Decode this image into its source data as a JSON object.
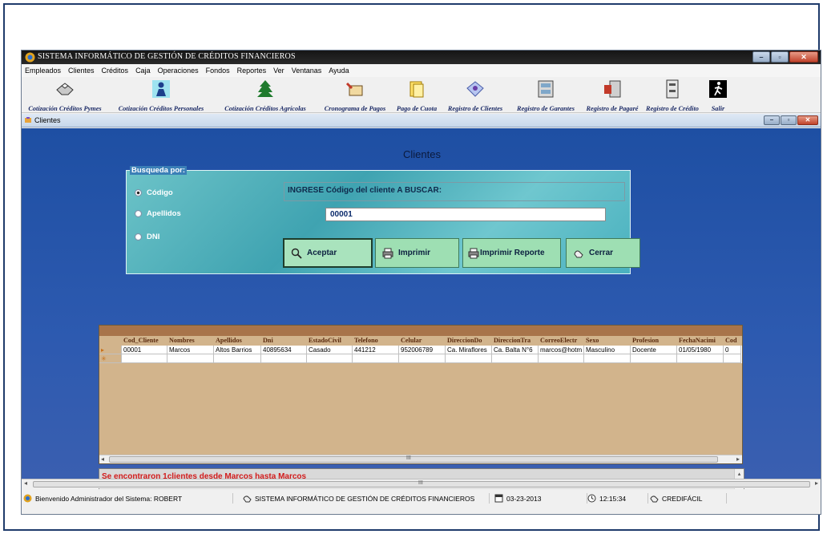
{
  "window": {
    "title": "SISTEMA INFORMÁTICO DE GESTIÓN DE CRÉDITOS FINANCIEROS"
  },
  "menu": [
    "Empleados",
    "Clientes",
    "Créditos",
    "Caja",
    "Operaciones",
    "Fondos",
    "Reportes",
    "Ver",
    "Ventanas",
    "Ayuda"
  ],
  "toolbar": [
    {
      "label": "Cotización Créditos Pymes",
      "icon": "shaking-hands-icon"
    },
    {
      "label": "Cotización Créditos Personales",
      "icon": "person-icon"
    },
    {
      "label": "Cotización Créditos Agrícolas",
      "icon": "tree-icon"
    },
    {
      "label": "Cronograma de Pagos",
      "icon": "calendar-icon"
    },
    {
      "label": "Pago de Cuota",
      "icon": "payment-icon"
    },
    {
      "label": "Registro de Clientes",
      "icon": "clients-icon"
    },
    {
      "label": "Registro de Garantes",
      "icon": "guarantors-icon"
    },
    {
      "label": "Registro de Pagaré",
      "icon": "promissory-note-icon"
    },
    {
      "label": "Registro de Crédito",
      "icon": "credit-cabinet-icon"
    },
    {
      "label": "Salir",
      "icon": "exit-icon"
    }
  ],
  "child": {
    "title": "Clientes",
    "form_title": "Clientes",
    "busqueda": {
      "legend": "Busqueda por:",
      "options": [
        "Código",
        "Apellidos",
        "DNI"
      ],
      "selected": "Código",
      "prompt": "INGRESE Código del cliente  A BUSCAR:",
      "value": "00001"
    },
    "buttons": {
      "aceptar": "Aceptar",
      "imprimir": "Imprimir",
      "imprimir_reporte": "Imprimir Reporte",
      "cerrar": "Cerrar"
    },
    "grid": {
      "columns": [
        "Cod_Cliente",
        "Nombres",
        "Apellidos",
        "Dni",
        "EstadoCivil",
        "Telefono",
        "Celular",
        "DireccionDo",
        "DireccionTra",
        "CorreoElectr",
        "Sexo",
        "Profesion",
        "FechaNacimi",
        "Cod"
      ],
      "rows": [
        [
          "00001",
          "Marcos",
          "Altos Barrios",
          "40895634",
          "Casado",
          "441212",
          "952006789",
          "Ca. Miraflores",
          "Ca. Balta N°6",
          "marcos@hotm",
          "Masculino",
          "Docente",
          "01/05/1980",
          "0"
        ]
      ],
      "scroll_glyph": "III"
    },
    "message": "Se encontraron  1clientes desde Marcos hasta Marcos"
  },
  "statusbar": {
    "user": "Bienvenido Administrador del Sistema: ROBERT",
    "system": "SISTEMA INFORMÁTICO DE GESTIÓN DE CRÉDITOS FINANCIEROS",
    "date": "03-23-2013",
    "time": "12:15:34",
    "app": "CREDIFÁCIL"
  },
  "colors": {
    "client_bg": "#2d5ab0",
    "search_panel": "#4ab1bf",
    "grid_bg": "#d2b48c",
    "message": "#d21b1b"
  }
}
